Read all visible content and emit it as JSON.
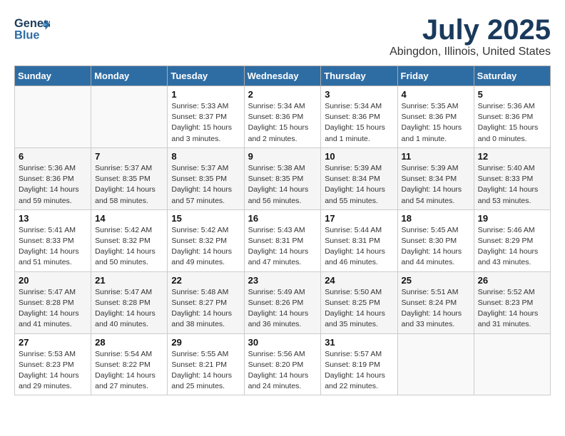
{
  "header": {
    "logo_general": "General",
    "logo_blue": "Blue",
    "title": "July 2025",
    "location": "Abingdon, Illinois, United States"
  },
  "weekdays": [
    "Sunday",
    "Monday",
    "Tuesday",
    "Wednesday",
    "Thursday",
    "Friday",
    "Saturday"
  ],
  "weeks": [
    [
      {
        "day": "",
        "info": ""
      },
      {
        "day": "",
        "info": ""
      },
      {
        "day": "1",
        "info": "Sunrise: 5:33 AM\nSunset: 8:37 PM\nDaylight: 15 hours\nand 3 minutes."
      },
      {
        "day": "2",
        "info": "Sunrise: 5:34 AM\nSunset: 8:36 PM\nDaylight: 15 hours\nand 2 minutes."
      },
      {
        "day": "3",
        "info": "Sunrise: 5:34 AM\nSunset: 8:36 PM\nDaylight: 15 hours\nand 1 minute."
      },
      {
        "day": "4",
        "info": "Sunrise: 5:35 AM\nSunset: 8:36 PM\nDaylight: 15 hours\nand 1 minute."
      },
      {
        "day": "5",
        "info": "Sunrise: 5:36 AM\nSunset: 8:36 PM\nDaylight: 15 hours\nand 0 minutes."
      }
    ],
    [
      {
        "day": "6",
        "info": "Sunrise: 5:36 AM\nSunset: 8:36 PM\nDaylight: 14 hours\nand 59 minutes."
      },
      {
        "day": "7",
        "info": "Sunrise: 5:37 AM\nSunset: 8:35 PM\nDaylight: 14 hours\nand 58 minutes."
      },
      {
        "day": "8",
        "info": "Sunrise: 5:37 AM\nSunset: 8:35 PM\nDaylight: 14 hours\nand 57 minutes."
      },
      {
        "day": "9",
        "info": "Sunrise: 5:38 AM\nSunset: 8:35 PM\nDaylight: 14 hours\nand 56 minutes."
      },
      {
        "day": "10",
        "info": "Sunrise: 5:39 AM\nSunset: 8:34 PM\nDaylight: 14 hours\nand 55 minutes."
      },
      {
        "day": "11",
        "info": "Sunrise: 5:39 AM\nSunset: 8:34 PM\nDaylight: 14 hours\nand 54 minutes."
      },
      {
        "day": "12",
        "info": "Sunrise: 5:40 AM\nSunset: 8:33 PM\nDaylight: 14 hours\nand 53 minutes."
      }
    ],
    [
      {
        "day": "13",
        "info": "Sunrise: 5:41 AM\nSunset: 8:33 PM\nDaylight: 14 hours\nand 51 minutes."
      },
      {
        "day": "14",
        "info": "Sunrise: 5:42 AM\nSunset: 8:32 PM\nDaylight: 14 hours\nand 50 minutes."
      },
      {
        "day": "15",
        "info": "Sunrise: 5:42 AM\nSunset: 8:32 PM\nDaylight: 14 hours\nand 49 minutes."
      },
      {
        "day": "16",
        "info": "Sunrise: 5:43 AM\nSunset: 8:31 PM\nDaylight: 14 hours\nand 47 minutes."
      },
      {
        "day": "17",
        "info": "Sunrise: 5:44 AM\nSunset: 8:31 PM\nDaylight: 14 hours\nand 46 minutes."
      },
      {
        "day": "18",
        "info": "Sunrise: 5:45 AM\nSunset: 8:30 PM\nDaylight: 14 hours\nand 44 minutes."
      },
      {
        "day": "19",
        "info": "Sunrise: 5:46 AM\nSunset: 8:29 PM\nDaylight: 14 hours\nand 43 minutes."
      }
    ],
    [
      {
        "day": "20",
        "info": "Sunrise: 5:47 AM\nSunset: 8:28 PM\nDaylight: 14 hours\nand 41 minutes."
      },
      {
        "day": "21",
        "info": "Sunrise: 5:47 AM\nSunset: 8:28 PM\nDaylight: 14 hours\nand 40 minutes."
      },
      {
        "day": "22",
        "info": "Sunrise: 5:48 AM\nSunset: 8:27 PM\nDaylight: 14 hours\nand 38 minutes."
      },
      {
        "day": "23",
        "info": "Sunrise: 5:49 AM\nSunset: 8:26 PM\nDaylight: 14 hours\nand 36 minutes."
      },
      {
        "day": "24",
        "info": "Sunrise: 5:50 AM\nSunset: 8:25 PM\nDaylight: 14 hours\nand 35 minutes."
      },
      {
        "day": "25",
        "info": "Sunrise: 5:51 AM\nSunset: 8:24 PM\nDaylight: 14 hours\nand 33 minutes."
      },
      {
        "day": "26",
        "info": "Sunrise: 5:52 AM\nSunset: 8:23 PM\nDaylight: 14 hours\nand 31 minutes."
      }
    ],
    [
      {
        "day": "27",
        "info": "Sunrise: 5:53 AM\nSunset: 8:23 PM\nDaylight: 14 hours\nand 29 minutes."
      },
      {
        "day": "28",
        "info": "Sunrise: 5:54 AM\nSunset: 8:22 PM\nDaylight: 14 hours\nand 27 minutes."
      },
      {
        "day": "29",
        "info": "Sunrise: 5:55 AM\nSunset: 8:21 PM\nDaylight: 14 hours\nand 25 minutes."
      },
      {
        "day": "30",
        "info": "Sunrise: 5:56 AM\nSunset: 8:20 PM\nDaylight: 14 hours\nand 24 minutes."
      },
      {
        "day": "31",
        "info": "Sunrise: 5:57 AM\nSunset: 8:19 PM\nDaylight: 14 hours\nand 22 minutes."
      },
      {
        "day": "",
        "info": ""
      },
      {
        "day": "",
        "info": ""
      }
    ]
  ]
}
